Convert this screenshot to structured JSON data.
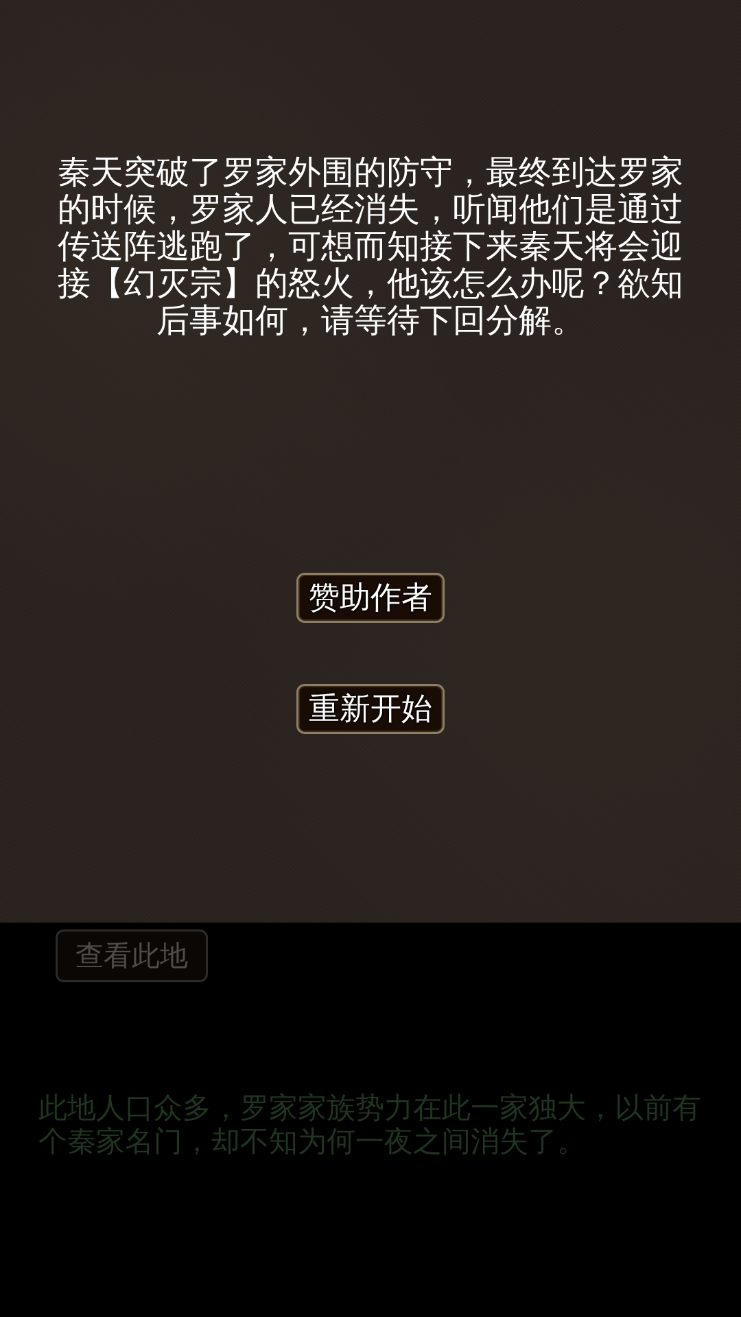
{
  "story": {
    "text": "秦天突破了罗家外围的防守，最终到达罗家的时候，罗家人已经消失，听闻他们是通过传送阵逃跑了，可想而知接下来秦天将会迎接【幻灭宗】的怒火，他该怎么办呢？欲知后事如何，请等待下回分解。"
  },
  "buttons": [
    {
      "label": "赞助作者",
      "disabled": false
    },
    {
      "label": "重新开始",
      "disabled": false
    }
  ],
  "location_panel": {
    "button": {
      "label": "查看此地",
      "disabled": true
    },
    "description": "此地人口众多，罗家家族势力在此一家独大，以前有个秦家名门，却不知为何一夜之间消失了。"
  }
}
